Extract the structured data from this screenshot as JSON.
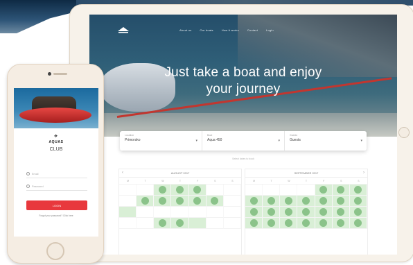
{
  "colors": {
    "accent": "#8bc38a",
    "button": "#e8383d",
    "hero_text": "#ffffff"
  },
  "tablet": {
    "logo_icon": "boat-logo-icon",
    "nav": [
      "About us",
      "Our boats",
      "How it works",
      "Contact",
      "Login"
    ],
    "hero_title_line1": "Just take a boat and enjoy",
    "hero_title_line2": "your journey",
    "search": {
      "fields": [
        {
          "label": "Location",
          "value": "Primorsko",
          "icon": "chevron-down-icon"
        },
        {
          "label": "Boat",
          "value": "Aqua 450",
          "icon": "chevron-down-icon"
        },
        {
          "label": "Guests",
          "value": "Guests",
          "icon": "chevron-down-icon"
        }
      ]
    },
    "hint": "Select dates to book",
    "calendar": {
      "months": [
        "AUGUST 2017",
        "SEPTEMBER 2017"
      ],
      "days_of_week": [
        "M",
        "T",
        "W",
        "T",
        "F",
        "S",
        "S"
      ]
    }
  },
  "phone": {
    "brand_mark": "✈",
    "brand_name": "AQUAS",
    "brand_sub": "CLUB",
    "email_placeholder": "Email",
    "password_placeholder": "Password",
    "login_label": "LOGIN",
    "forgot": "Forgot your password? Click here"
  }
}
